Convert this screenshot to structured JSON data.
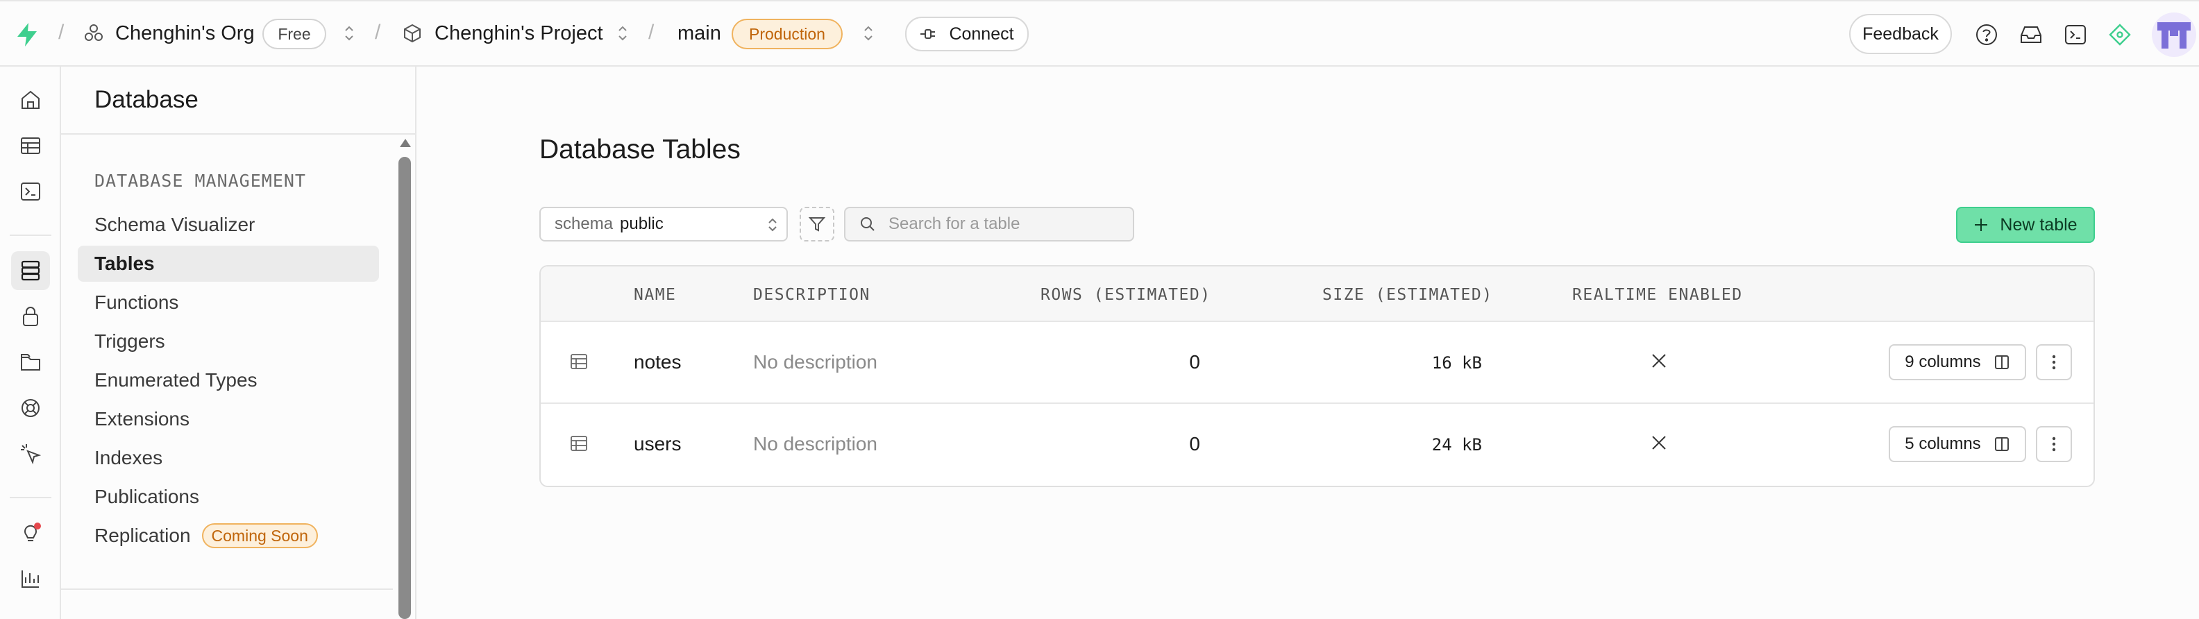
{
  "topbar": {
    "org_name": "Chenghin's Org",
    "plan_badge": "Free",
    "project_name": "Chenghin's Project",
    "branch_name": "main",
    "env_badge": "Production",
    "connect_label": "Connect",
    "feedback_label": "Feedback",
    "icons": [
      "supabase-logo-icon",
      "org-icon",
      "project-box-icon",
      "help-icon",
      "inbox-icon",
      "terminal-icon",
      "advisor-icon",
      "avatar"
    ]
  },
  "rail": {
    "items": [
      "home-icon",
      "table-editor-icon",
      "sql-editor-icon",
      "database-icon",
      "auth-icon",
      "storage-icon",
      "realtime-icon",
      "edge-functions-icon",
      "advisors-icon",
      "reports-icon"
    ],
    "active": "database-icon"
  },
  "sidebar": {
    "title": "Database",
    "section_label": "DATABASE MANAGEMENT",
    "items": [
      {
        "label": "Schema Visualizer"
      },
      {
        "label": "Tables"
      },
      {
        "label": "Functions"
      },
      {
        "label": "Triggers"
      },
      {
        "label": "Enumerated Types"
      },
      {
        "label": "Extensions"
      },
      {
        "label": "Indexes"
      },
      {
        "label": "Publications"
      },
      {
        "label": "Replication",
        "badge": "Coming Soon"
      }
    ],
    "active_item": "Tables"
  },
  "main": {
    "title": "Database Tables",
    "schema_label": "schema",
    "schema_value": "public",
    "search_placeholder": "Search for a table",
    "new_table_label": "New table",
    "table": {
      "headers": [
        "NAME",
        "DESCRIPTION",
        "ROWS (ESTIMATED)",
        "SIZE (ESTIMATED)",
        "REALTIME ENABLED"
      ],
      "rows": [
        {
          "name": "notes",
          "description": "No description",
          "rows": "0",
          "size": "16 kB",
          "realtime": "disabled",
          "columns_label": "9 columns"
        },
        {
          "name": "users",
          "description": "No description",
          "rows": "0",
          "size": "24 kB",
          "realtime": "disabled",
          "columns_label": "5 columns"
        }
      ]
    }
  },
  "colors": {
    "accent_green": "#3ecf8e",
    "new_table_bg": "#6fe0a8",
    "warning_orange": "#c0650a",
    "warning_bg": "#fdf0dc",
    "notification_dot": "#e5484d",
    "avatar_purple": "#7b6fd8"
  }
}
